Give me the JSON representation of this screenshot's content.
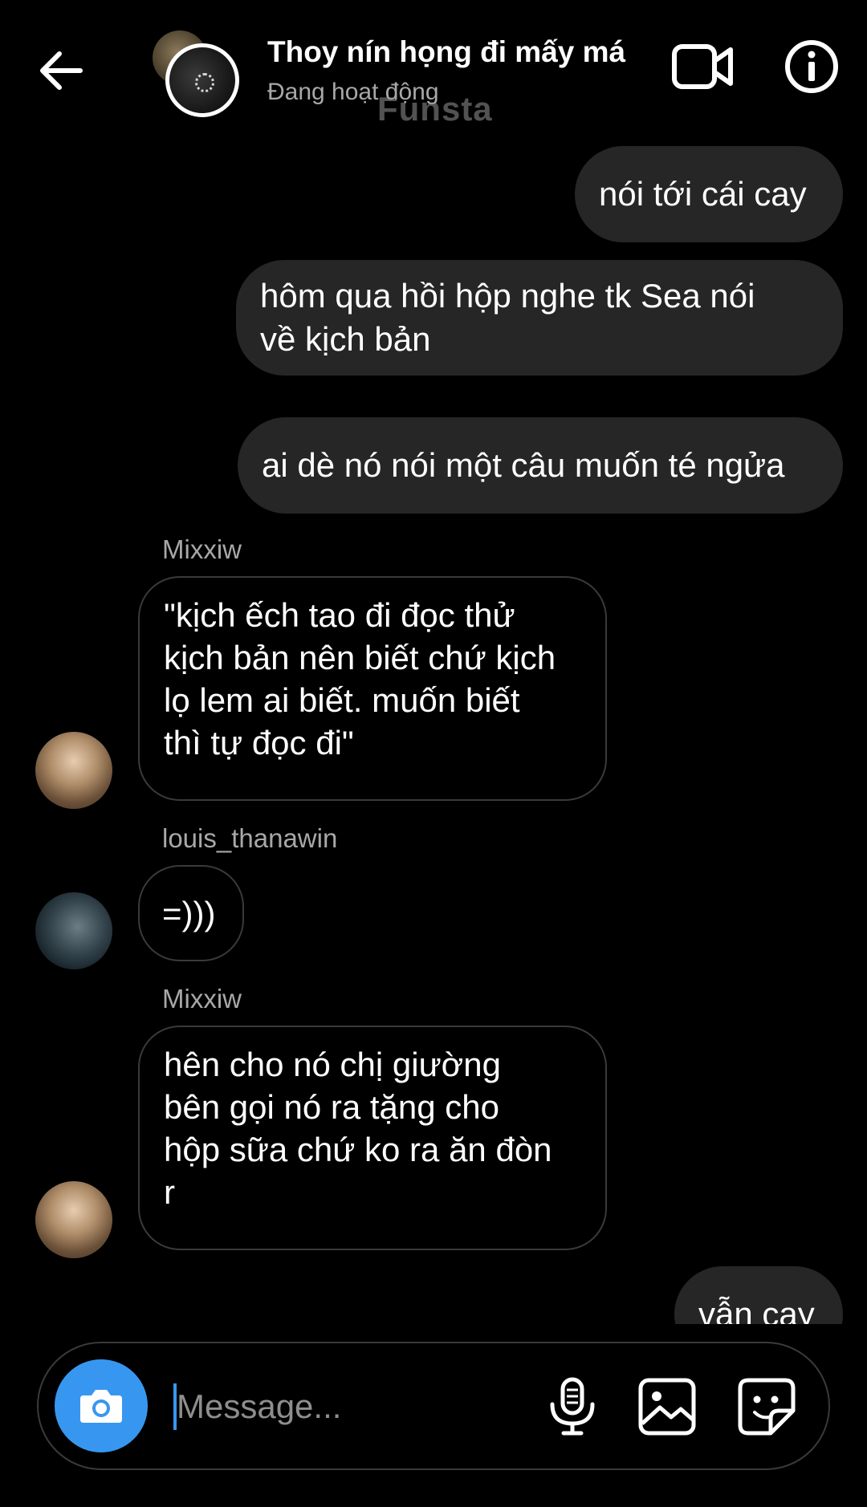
{
  "header": {
    "title": "Thoy nín họng đi mấy má",
    "status": "Đang hoạt động",
    "watermark": "Funsta",
    "icons": {
      "back": "arrow-left-icon",
      "video": "video-camera-icon",
      "info": "info-icon"
    }
  },
  "messages": {
    "out1": "nói tới cái cay",
    "out2": "hôm qua hồi hộp nghe tk Sea nói\nvề kịch bản",
    "out3": "ai dè nó nói một câu muốn té ngửa",
    "in1_sender": "Mixxiw",
    "in1_text": "\"kịch ếch tao đi đọc thử\nkịch bản nên biết chứ kịch\nlọ lem ai biết. muốn biết\nthì tự đọc đi\"",
    "in2_sender": "louis_thanawin",
    "in2_text": "=)))",
    "in3_sender": "Mixxiw",
    "in3_text": "hên cho nó chị giường\nbên gọi nó ra tặng cho\nhộp sữa chứ ko ra ăn đòn\nr",
    "out4": "vẫn cay"
  },
  "composer": {
    "placeholder": "Message...",
    "icons": {
      "camera": "camera-icon",
      "mic": "microphone-icon",
      "gallery": "image-icon",
      "sticker": "sticker-icon"
    }
  },
  "colors": {
    "background": "#000000",
    "outgoing_bubble": "#262626",
    "incoming_border": "#3a3a3a",
    "secondary_text": "#a8a8a8",
    "accent": "#3797f0"
  }
}
